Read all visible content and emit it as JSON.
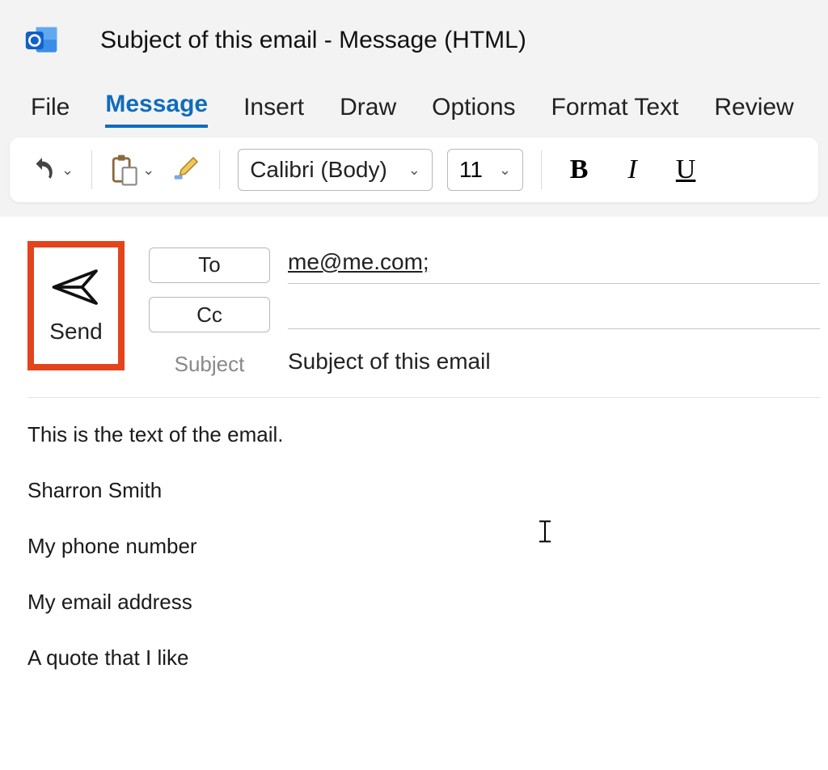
{
  "window": {
    "title": "Subject of this email  -  Message (HTML)"
  },
  "ribbon": {
    "tabs": {
      "file": "File",
      "message": "Message",
      "insert": "Insert",
      "draw": "Draw",
      "options": "Options",
      "format_text": "Format Text",
      "review": "Review"
    }
  },
  "toolbar": {
    "font_name": "Calibri (Body)",
    "font_size": "11",
    "bold": "B",
    "italic": "I",
    "underline": "U"
  },
  "compose": {
    "send_label": "Send",
    "to_label": "To",
    "cc_label": "Cc",
    "subject_label": "Subject",
    "to_value": "me@me.com;",
    "cc_value": "",
    "subject_value": "Subject of this email"
  },
  "body": {
    "line1": "This is the text of the email.",
    "sig1": "Sharron Smith",
    "sig2": "My phone number",
    "sig3": "My email address",
    "sig4": "A quote that I like"
  }
}
